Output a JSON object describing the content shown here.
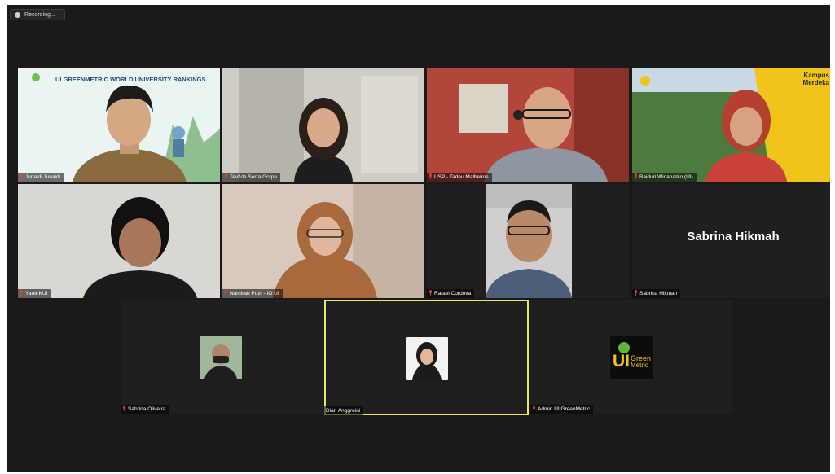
{
  "recording": {
    "label": "Recording..."
  },
  "banner_text": "UI GREENMETRIC WORLD UNIVERSITY RANKINGS",
  "kampus_text": [
    "Kampus",
    "Merdeka"
  ],
  "logo_text": {
    "brand": "Green",
    "sub": "Metric",
    "letters": "UI"
  },
  "participants": [
    {
      "name": "Junaidi Junaidi",
      "muted": true
    },
    {
      "name": "Tevfide Serra Gorpe",
      "muted": true
    },
    {
      "name": "USP - Tadeu Malheiros",
      "muted": true
    },
    {
      "name": "Baiduri Widanarko (UI)",
      "muted": true
    },
    {
      "name": "Yanti-KUI",
      "muted": true
    },
    {
      "name": "Namirah Putri - IO UI",
      "muted": true
    },
    {
      "name": "Rafael Cordova",
      "muted": true
    },
    {
      "name": "Sabrina Hikmah",
      "muted": true,
      "display_name": "Sabrina Hikmah"
    },
    {
      "name": "Sabrina Oliveira",
      "muted": true
    },
    {
      "name": "Dian Anggreini",
      "muted": false,
      "active_speaker": true
    },
    {
      "name": "Admin UI GreenMetric",
      "muted": true
    }
  ],
  "colors": {
    "background": "#1a1a1a",
    "active_border": "#e9e76b",
    "muted_mic": "#e0443c"
  }
}
